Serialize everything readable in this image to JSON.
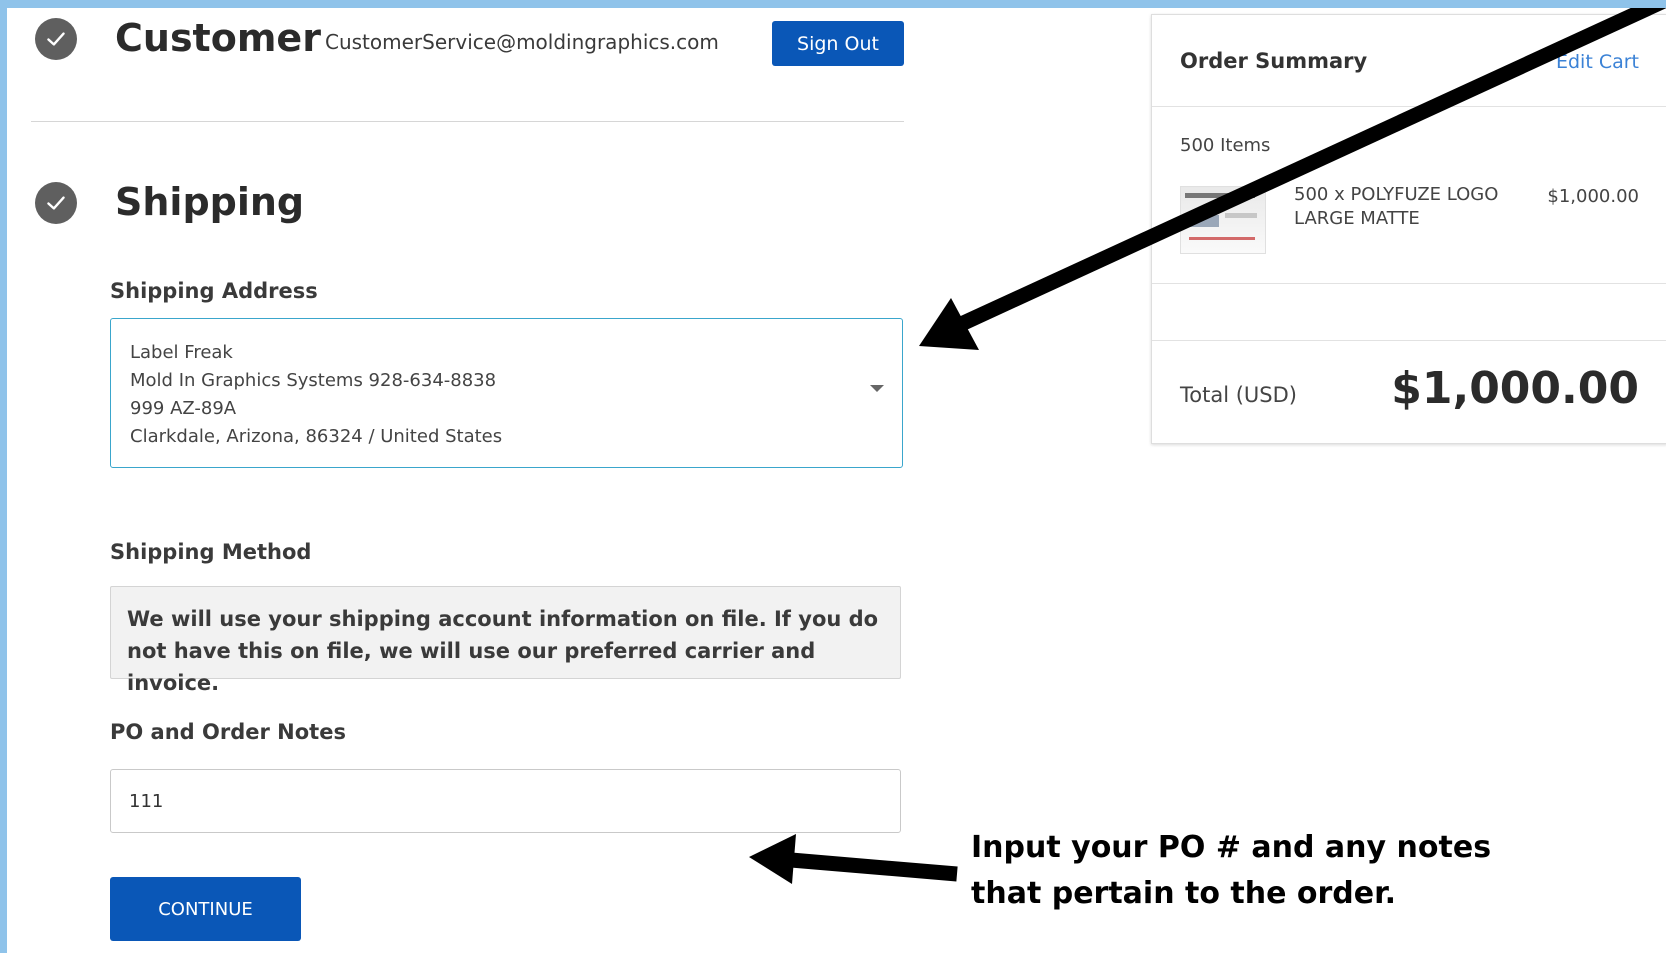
{
  "customer": {
    "title": "Customer",
    "email": "CustomerService@moldingraphics.com",
    "sign_out_label": "Sign Out"
  },
  "shipping": {
    "title": "Shipping",
    "address_label": "Shipping Address",
    "address_lines": [
      "Label Freak",
      "Mold In Graphics Systems 928-634-8838",
      "999 AZ-89A",
      "Clarkdale, Arizona, 86324 / United States"
    ],
    "method_label": "Shipping Method",
    "method_text": "We will use your shipping account information on file. If you do not have this on file, we will use our preferred carrier and invoice.",
    "notes_label": "PO and Order Notes",
    "notes_value": "111",
    "continue_label": "CONTINUE"
  },
  "summary": {
    "title": "Order Summary",
    "edit_label": "Edit Cart",
    "items_count": "500 Items",
    "item_name": "500 x POLYFUZE LOGO LARGE MATTE",
    "item_price": "$1,000.00",
    "total_label": "Total (USD)",
    "total_value": "$1,000.00"
  },
  "annotation": {
    "line1": "Input your PO # and any notes",
    "line2": "that pertain to the order."
  },
  "colors": {
    "frame": "#8fc3ea",
    "primary_button": "#0a57b7",
    "link": "#3b82d6",
    "focus_border": "#3aa6cc"
  },
  "icons": [
    "check-icon",
    "caret-down-icon",
    "arrow-annotation"
  ]
}
